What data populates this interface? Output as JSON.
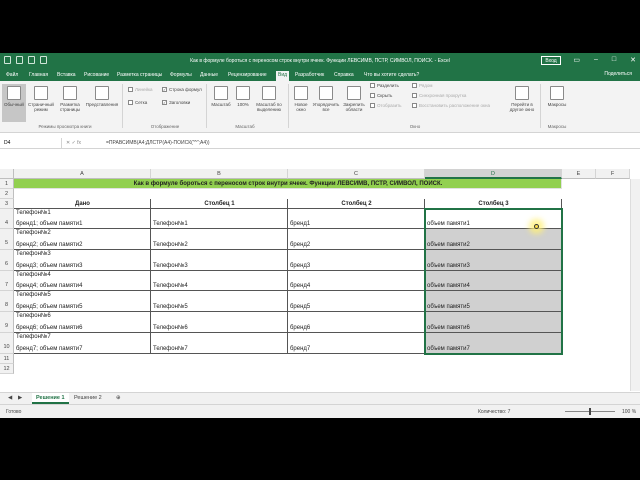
{
  "window": {
    "title": "Как в формуле бороться с переносом строк внутри ячеек. Функции ЛЕВСИМВ, ПСТР, СИМВОЛ, ПОИСК. - Excel",
    "signin": "Вход",
    "share": "Поделиться"
  },
  "ribbon_tabs": [
    "Файл",
    "Главная",
    "Вставка",
    "Рисование",
    "Разметка страницы",
    "Формулы",
    "Данные",
    "Рецензирование",
    "Вид",
    "Разработчик",
    "Справка",
    "Что вы хотите сделать?"
  ],
  "ribbon": {
    "views": [
      "Обычный",
      "Страничный режим",
      "Разметка страницы",
      "Представления"
    ],
    "views_group": "Режимы просмотра книги",
    "show": {
      "ruler": "Линейка",
      "formula_bar": "Строка формул",
      "gridlines": "Сетка",
      "headings": "Заголовки",
      "group": "Отображение"
    },
    "zoom": [
      "Масштаб",
      "100%",
      "Масштаб по выделению"
    ],
    "zoom_group": "Масштаб",
    "window": [
      "Новое окно",
      "Упорядочить все",
      "Закрепить области"
    ],
    "window_small": [
      "Разделить",
      "Скрыть",
      "Отобразить"
    ],
    "window_small2": [
      "Рядом",
      "Синхронная прокрутка",
      "Восстановить расположение окна"
    ],
    "switch": "Перейти в другое окно",
    "window_group": "Окно",
    "macros": "Макросы",
    "macros_group": "Макросы"
  },
  "formula_bar": {
    "name_box": "D4",
    "fx": "✕ ✓ fx",
    "formula": "=ПРАВСИМВ(A4;ДЛСТР(A4)-ПОИСК(\"^\";A4))"
  },
  "columns": [
    "A",
    "B",
    "C",
    "D",
    "E",
    "F"
  ],
  "rows": [
    "1",
    "2",
    "3",
    "4",
    "5",
    "6",
    "7",
    "8",
    "9",
    "10",
    "11",
    "12"
  ],
  "sheet": {
    "title": "Как в формуле бороться с переносом строк внутри ячеек. Функции ЛЕВСИМВ, ПСТР, СИМВОЛ, ПОИСК.",
    "headers": [
      "Дано",
      "Столбец 1",
      "Столбец 2",
      "Столбец 3"
    ],
    "data": [
      {
        "a1": "Телефон№1",
        "a2": "бренд1; объем памяти1",
        "b": "Телефон№1",
        "c": "бренд1",
        "d": "объем памяти1"
      },
      {
        "a1": "Телефон№2",
        "a2": "бренд2; объем памяти2",
        "b": "Телефон№2",
        "c": "бренд2",
        "d": "объем памяти2"
      },
      {
        "a1": "Телефон№3",
        "a2": "бренд3; объем памяти3",
        "b": "Телефон№3",
        "c": "бренд3",
        "d": "объем памяти3"
      },
      {
        "a1": "Телефон№4",
        "a2": "бренд4; объем памяти4",
        "b": "Телефон№4",
        "c": "бренд4",
        "d": "объем памяти4"
      },
      {
        "a1": "Телефон№5",
        "a2": "бренд5; объем памяти5",
        "b": "Телефон№5",
        "c": "бренд5",
        "d": "объем памяти5"
      },
      {
        "a1": "Телефон№6",
        "a2": "бренд6; объем памяти6",
        "b": "Телефон№6",
        "c": "бренд6",
        "d": "объем памяти6"
      },
      {
        "a1": "Телефон№7",
        "a2": "бренд7; объем памяти7",
        "b": "Телефон№7",
        "c": "бренд7",
        "d": "объем памяти7"
      }
    ]
  },
  "sheet_tabs": [
    "Решение 1",
    "Решение 2"
  ],
  "status": {
    "ready": "Готово",
    "count": "Количество: 7",
    "zoom": "100 %"
  }
}
